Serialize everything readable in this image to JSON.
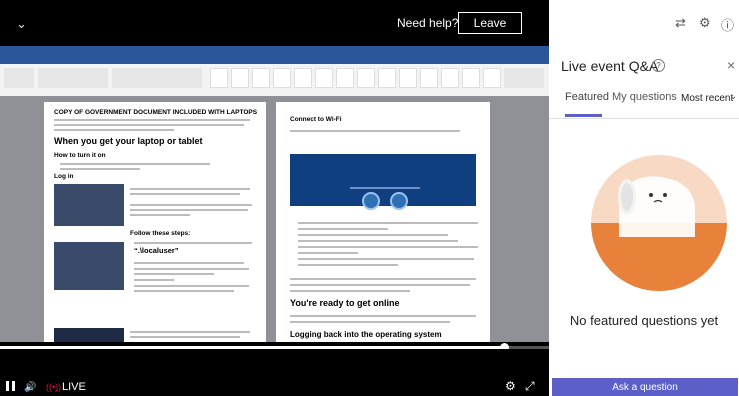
{
  "player": {
    "back_glyph": "⌄",
    "need_help": "Need help?",
    "leave_label": "Leave",
    "live_label": "LIVE",
    "live_indicator": "((•))",
    "progress": 0.92,
    "icons": [
      "pause-icon",
      "volume-icon",
      "settings-icon",
      "expand-icon"
    ]
  },
  "document": {
    "left_title": "COPY OF GOVERNMENT DOCUMENT INCLUDED WITH LAPTOPS",
    "left_h1": "When you get your laptop or tablet",
    "left_h2": "How to turn it on",
    "left_h3": "Log in",
    "left_h4": "Follow these steps:",
    "localuser": "“.\\localuser”",
    "right_title": "Connect to Wi-Fi",
    "right_h1": "You're ready to get online",
    "right_h2": "Logging back into the operating system"
  },
  "panel": {
    "title": "Live event Q&A",
    "info_glyph": "?",
    "close_glyph": "×",
    "tabs": [
      "Featured",
      "My questions"
    ],
    "sort_value": "Most recent",
    "empty_message": "No featured questions yet",
    "ask_button": "Ask a question",
    "top_icons": [
      "translate-icon",
      "settings-icon",
      "info-icon"
    ]
  },
  "colors": {
    "accent": "#5b5fc7",
    "word_blue": "#2b579a",
    "illustration_orange": "#e8823a"
  }
}
